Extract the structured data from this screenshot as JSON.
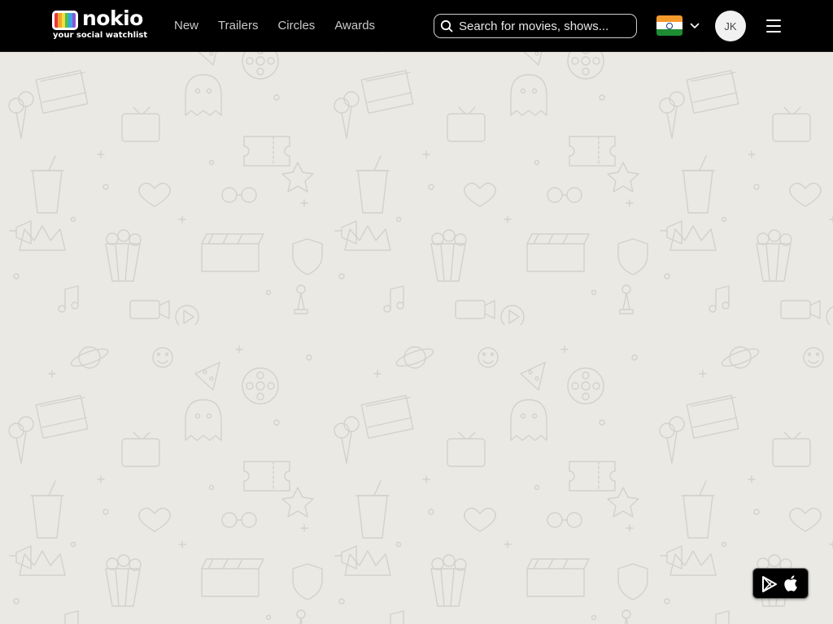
{
  "header": {
    "logo": {
      "wordmark": "nokio",
      "tagline": "your social watchlist",
      "bar_colors": [
        "#e23b3b",
        "#f2a52c",
        "#f5df3a",
        "#4fbf5a",
        "#3aa6df",
        "#8a55d6"
      ]
    },
    "nav": [
      {
        "label": "New"
      },
      {
        "label": "Trailers"
      },
      {
        "label": "Circles"
      },
      {
        "label": "Awards"
      }
    ],
    "search": {
      "placeholder": "Search for movies, shows...",
      "value": "",
      "icon": "search-icon"
    },
    "country": {
      "flag": "india-flag-icon",
      "flag_colors": [
        "#f39a2d",
        "#ffffff",
        "#1e8c33"
      ],
      "icon": "chevron-down-icon"
    },
    "avatar": {
      "initials": "JK"
    },
    "menu": {
      "icon": "hamburger-menu-icon"
    }
  },
  "background": {
    "color": "#ebe9e4",
    "pattern_color": "#d3d1cc",
    "pattern": "doodle-icons"
  },
  "store_badge": {
    "icons": [
      "google-play-icon",
      "apple-icon"
    ]
  },
  "colors": {
    "header_bg": "#000000",
    "nav_text": "#c9c9c9",
    "accent": "#ffffff"
  }
}
